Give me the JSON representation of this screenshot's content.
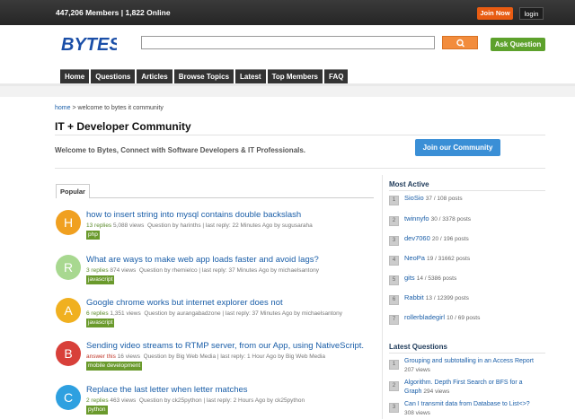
{
  "header": {
    "stats": "447,206 Members | 1,822 Online",
    "join_label": "Join Now",
    "login_label": "login",
    "logo_text": "BYTES",
    "search_placeholder": "",
    "ask_label": "Ask Question",
    "accent_orange": "#e85c12",
    "accent_green": "#5da12c"
  },
  "nav": {
    "items": [
      "Home",
      "Questions",
      "Articles",
      "Browse Topics",
      "Latest",
      "Top Members",
      "FAQ"
    ]
  },
  "breadcrumb": {
    "home": "home",
    "separator": ">",
    "current": "welcome to bytes it community"
  },
  "page": {
    "title": "IT + Developer Community",
    "welcome": "Welcome to Bytes, Connect with Software Developers & IT Professionals.",
    "join_community_label": "Join our Community"
  },
  "tabs": {
    "popular": "Popular"
  },
  "questions": [
    {
      "avatar_letter": "H",
      "avatar_color": "#f0a020",
      "title": "how to insert string into mysql contains double backslash",
      "replies": "13 replies",
      "views": "5,088 views",
      "meta": "Question by harinths | last reply: 22 Minutes Ago by sugusaraha",
      "tag": "php"
    },
    {
      "avatar_letter": "R",
      "avatar_color": "#a8d890",
      "title": "What are ways to make web app loads faster and avoid lags?",
      "replies": "3 replies",
      "views": "874 views",
      "meta": "Question by rhemielco | last reply: 37 Minutes Ago by michaelsantony",
      "tag": "javascript"
    },
    {
      "avatar_letter": "A",
      "avatar_color": "#f0b020",
      "title": "Google chrome works but internet explorer does not",
      "replies": "6 replies",
      "views": "1,351 views",
      "meta": "Question by aurangabadzone | last reply: 37 Minutes Ago by michaelsantony",
      "tag": "javascript"
    },
    {
      "avatar_letter": "B",
      "avatar_color": "#d8403a",
      "title": "Sending video streams to RTMP server, from our App, using NativeScript.",
      "replies": "answer this",
      "views": "16 views",
      "meta": "Question by Big Web Media | last reply: 1 Hour Ago by Big Web Media",
      "tag": "mobile development"
    },
    {
      "avatar_letter": "C",
      "avatar_color": "#2ea0e0",
      "title": "Replace the last letter when letter matches",
      "replies": "2 replies",
      "views": "463 views",
      "meta": "Question by ck25python | last reply: 2 Hours Ago by ck25python",
      "tag": "python"
    }
  ],
  "sidebar": {
    "most_active_heading": "Most Active",
    "members": [
      {
        "rank": "1",
        "name": "SioSio",
        "posts": "37 / 108 posts"
      },
      {
        "rank": "2",
        "name": "twinnyfo",
        "posts": "30 / 3378 posts"
      },
      {
        "rank": "3",
        "name": "dev7060",
        "posts": "20 / 196 posts"
      },
      {
        "rank": "4",
        "name": "NeoPa",
        "posts": "19 / 31662 posts"
      },
      {
        "rank": "5",
        "name": "gits",
        "posts": "14 / 5386 posts"
      },
      {
        "rank": "6",
        "name": "Rabbit",
        "posts": "13 / 12399 posts"
      },
      {
        "rank": "7",
        "name": "rollerbladegirl",
        "posts": "10 / 69 posts"
      }
    ],
    "latest_heading": "Latest Questions",
    "latest": [
      {
        "rank": "1",
        "title": "Grouping and subtotalling in an Access Report",
        "views": "207 views"
      },
      {
        "rank": "2",
        "title": "Algorithm. Depth First Search or BFS for a Graph",
        "views": "294 views"
      },
      {
        "rank": "3",
        "title": "Can I transmit data from Database to List<>?",
        "views": "308 views"
      }
    ]
  }
}
